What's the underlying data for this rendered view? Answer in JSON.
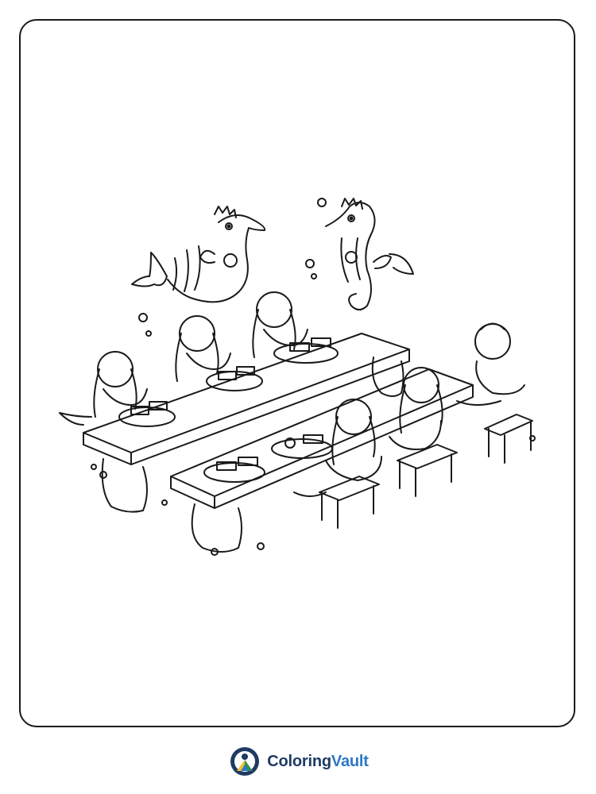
{
  "brand": {
    "name_part1": "Coloring",
    "name_part2": "Vault",
    "logo_icon": "coloringvault-logo-icon",
    "colors": {
      "navy": "#1f3b64",
      "blue": "#2c78c4",
      "yellow": "#f2c230",
      "green": "#2f8f5a"
    }
  },
  "page": {
    "frame_color": "#1a1a1a",
    "background": "#ffffff",
    "illustration_icon": "mermaids-lunch-table-illustration"
  }
}
